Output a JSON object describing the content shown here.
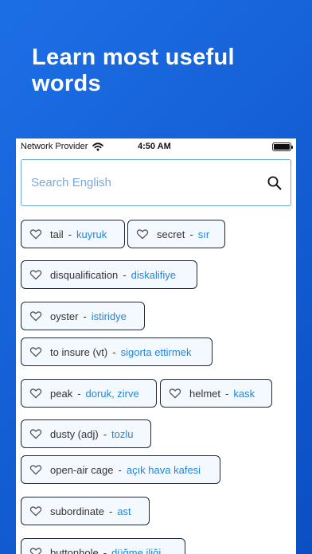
{
  "headline": "Learn most useful words",
  "status_bar": {
    "carrier": "Network Provider",
    "time": "4:50 AM"
  },
  "search": {
    "placeholder": "Search English"
  },
  "icons": {
    "heart": "heart-outline-icon",
    "search": "search-icon",
    "wifi": "wifi-icon",
    "battery": "battery-icon"
  },
  "colors": {
    "background": "#1560d6",
    "chip_background": "#f4f9ff",
    "translation": "#1f86e0",
    "search_border": "#6fa8dc"
  },
  "words": [
    {
      "en": "tail",
      "tr": "kuyruk"
    },
    {
      "en": "secret",
      "tr": "sır"
    },
    {
      "en": "disqualification",
      "tr": "diskalifiye"
    },
    {
      "en": "oyster",
      "tr": "istiridye"
    },
    {
      "en": "to insure (vt)",
      "tr": "sigorta ettirmek"
    },
    {
      "en": "peak",
      "tr": "doruk, zirve"
    },
    {
      "en": "helmet",
      "tr": "kask"
    },
    {
      "en": "dusty (adj)",
      "tr": "tozlu"
    },
    {
      "en": "open-air cage",
      "tr": "açık hava kafesi"
    },
    {
      "en": "subordinate",
      "tr": "ast"
    },
    {
      "en": "buttonhole",
      "tr": "düğme iliği"
    }
  ]
}
